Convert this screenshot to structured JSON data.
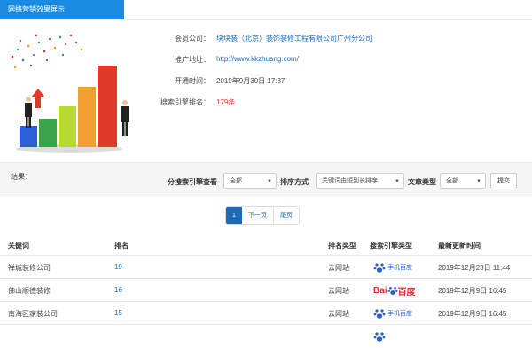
{
  "header": {
    "title": "网络营销效果展示"
  },
  "info": {
    "company_label": "会员公司：",
    "company_value": "块块装（北京）装饰装修工程有限公司广州分公司",
    "url_label": "推广地址：",
    "url_value": "http://www.kkzhuang.com/",
    "open_label": "开通时间：",
    "open_value": "2019年9月30日 17:37",
    "rank_label": "搜索引擎排名：",
    "rank_num": "179",
    "rank_unit": "条"
  },
  "filter": {
    "result_label": "结果：",
    "engine_label": "分搜索引擎查看",
    "engine_value": "全部",
    "sort_label": "排序方式",
    "sort_value": "关键词由短到长排序",
    "type_label": "文章类型",
    "type_value": "全部",
    "submit_label": "提交"
  },
  "pager": {
    "items": [
      "1",
      "下一页",
      "尾页"
    ]
  },
  "table": {
    "headers": [
      "关键词",
      "排名",
      "排名类型",
      "搜索引擎类型",
      "最新更新时间"
    ],
    "rows": [
      {
        "keyword": "禅城装修公司",
        "rank": "19",
        "type": "云网站",
        "engine": "手机百度",
        "engine_icon": "mobile-baidu",
        "time": "2019年12月23日 11:44"
      },
      {
        "keyword": "佛山顺德装修",
        "rank": "16",
        "type": "云网站",
        "engine": "百度",
        "engine_icon": "baidu-logo",
        "time": "2019年12月9日 16:45"
      },
      {
        "keyword": "南海区家装公司",
        "rank": "15",
        "type": "云网站",
        "engine": "手机百度",
        "engine_icon": "mobile-baidu",
        "time": "2019年12月9日 16:45"
      },
      {
        "keyword": "",
        "rank": "",
        "type": "",
        "engine": "",
        "engine_icon": "mobile-baidu",
        "time": ""
      }
    ]
  },
  "colors": {
    "accent": "#1a8be0",
    "link": "#1a6ab8",
    "rank_red": "#e33",
    "baidu_blue": "#2a62c9",
    "baidu_red": "#e4262d"
  }
}
